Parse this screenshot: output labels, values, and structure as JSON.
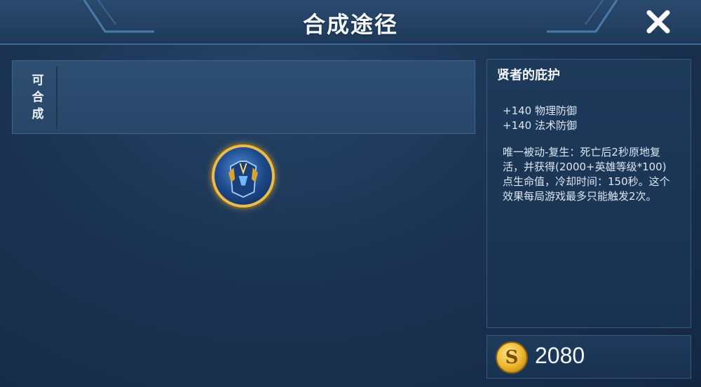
{
  "header": {
    "title": "合成途径"
  },
  "compose_panel": {
    "label_chars": [
      "可",
      "合",
      "成"
    ]
  },
  "item": {
    "icon": "armor-item-icon",
    "name": "贤者的庇护",
    "stats": [
      "+140 物理防御",
      "+140 法术防御"
    ],
    "description": "唯一被动-复生：死亡后2秒原地复活，并获得(2000+英雄等级*100)点生命值，冷却时间：150秒。这个效果每局游戏最多只能触发2次。",
    "price": "2080"
  },
  "colors": {
    "accent_gold": "#e6bd52",
    "panel_bg": "#1e3a5a"
  }
}
